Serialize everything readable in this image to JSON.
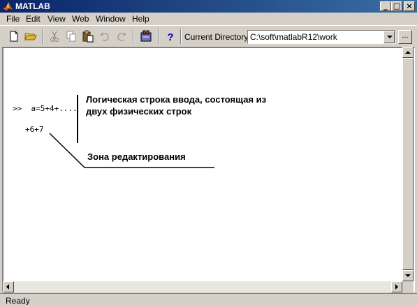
{
  "window": {
    "title": "MATLAB",
    "minimize": "_",
    "maximize": "□",
    "close": "×"
  },
  "menu": [
    "File",
    "Edit",
    "View",
    "Web",
    "Window",
    "Help"
  ],
  "toolbar": {
    "current_directory_label": "Current Directory:",
    "current_directory_value": "C:\\soft\\matlabR12\\work",
    "browse_label": "..."
  },
  "command": {
    "line1": ">>  a=5+4+....",
    "line2": "+6+7"
  },
  "annotations": {
    "logical_line_1": "Логическая строка ввода, состоящая из",
    "logical_line_2": "двух физических строк",
    "edit_zone": "Зона редактирования"
  },
  "status": "Ready"
}
